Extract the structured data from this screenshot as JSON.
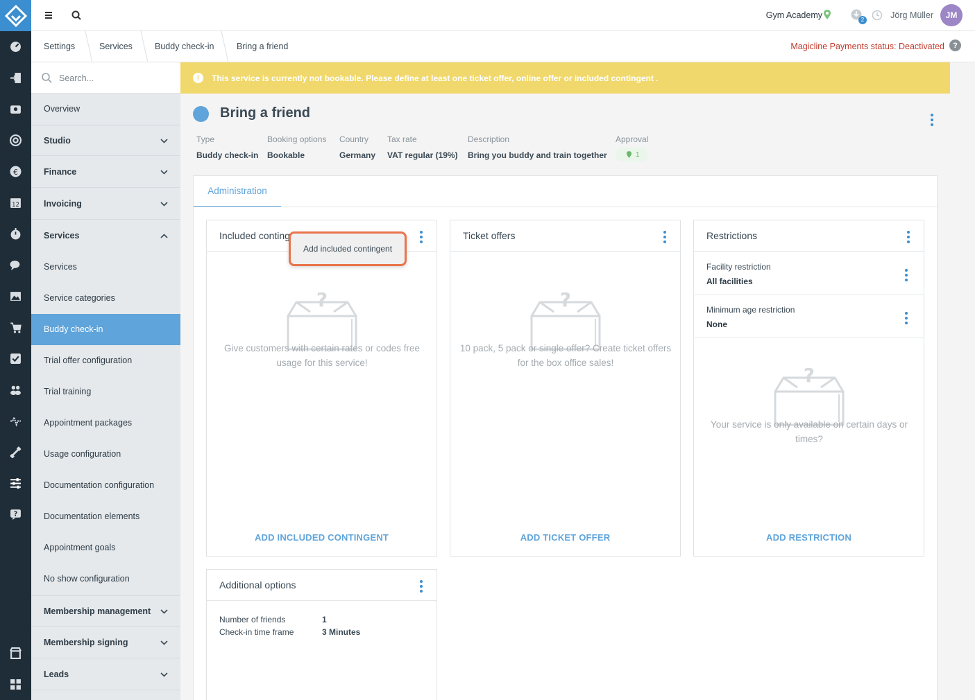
{
  "topbar": {
    "studio_name": "Gym Academy",
    "notification_count": "2",
    "user_name": "Jörg Müller",
    "user_initials": "JM"
  },
  "breadcrumb": [
    "Settings",
    "Services",
    "Buddy check-in",
    "Bring a friend"
  ],
  "payments_status": "Magicline Payments status: Deactivated",
  "sidebar": {
    "search_placeholder": "Search...",
    "items": [
      {
        "label": "Overview",
        "type": "section-plain"
      },
      {
        "label": "Studio",
        "type": "section"
      },
      {
        "label": "Finance",
        "type": "section"
      },
      {
        "label": "Invoicing",
        "type": "section"
      },
      {
        "label": "Services",
        "type": "section-open"
      },
      {
        "label": "Services",
        "type": "sub"
      },
      {
        "label": "Service categories",
        "type": "sub"
      },
      {
        "label": "Buddy check-in",
        "type": "sub-active"
      },
      {
        "label": "Trial offer configuration",
        "type": "sub"
      },
      {
        "label": "Trial training",
        "type": "sub"
      },
      {
        "label": "Appointment packages",
        "type": "sub"
      },
      {
        "label": "Usage configuration",
        "type": "sub"
      },
      {
        "label": "Documentation configuration",
        "type": "sub"
      },
      {
        "label": "Documentation elements",
        "type": "sub"
      },
      {
        "label": "Appointment goals",
        "type": "sub"
      },
      {
        "label": "No show configuration",
        "type": "sub"
      },
      {
        "label": "Membership management",
        "type": "section"
      },
      {
        "label": "Membership signing",
        "type": "section"
      },
      {
        "label": "Leads",
        "type": "section"
      }
    ]
  },
  "warning": "This service is currently not bookable. Please define at least one ticket offer, online offer or included contingent .",
  "service": {
    "title": "Bring a friend",
    "color": "#5fa4da",
    "meta": [
      {
        "key": "Type",
        "value": "Buddy check-in"
      },
      {
        "key": "Booking options",
        "value": "Bookable"
      },
      {
        "key": "Country",
        "value": "Germany"
      },
      {
        "key": "Tax rate",
        "value": "VAT regular (19%)"
      },
      {
        "key": "Description",
        "value": "Bring you buddy and train together"
      },
      {
        "key": "Approval",
        "value": "1"
      }
    ]
  },
  "tabs": {
    "administration": "Administration"
  },
  "cards": {
    "included": {
      "title": "Included contingent",
      "empty_text": "Give customers with certain rates or codes free usage for this service!",
      "action": "ADD INCLUDED CONTINGENT",
      "popover": "Add included contingent"
    },
    "tickets": {
      "title": "Ticket offers",
      "empty_text": "10 pack, 5 pack or single offer? Create ticket offers for the box office sales!",
      "action": "ADD TICKET OFFER"
    },
    "restrictions": {
      "title": "Restrictions",
      "rows": [
        {
          "key": "Facility restriction",
          "value": "All facilities"
        },
        {
          "key": "Minimum age restriction",
          "value": "None"
        }
      ],
      "empty_text": "Your service is only available on certain days or times?",
      "action": "ADD RESTRICTION"
    },
    "additional": {
      "title": "Additional options",
      "rows": [
        {
          "key": "Number of friends",
          "value": "1"
        },
        {
          "key": "Check-in time frame",
          "value": "3 Minutes"
        }
      ]
    }
  },
  "colors": {
    "accent": "#5fa4da",
    "rail": "#1e2d38",
    "warning": "#f0d86c",
    "danger": "#c0392b",
    "highlight": "#e9744a"
  }
}
